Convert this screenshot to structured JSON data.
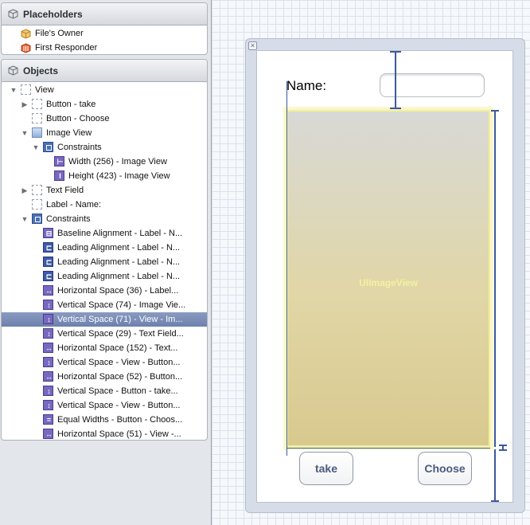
{
  "placeholders": {
    "header": "Placeholders",
    "items": [
      {
        "label": "File's Owner",
        "icon": "files-owner-icon"
      },
      {
        "label": "First Responder",
        "icon": "first-responder-icon"
      }
    ]
  },
  "objects": {
    "header": "Objects",
    "rows": [
      {
        "label": "View",
        "icon": "view-icon",
        "disclosure": "open"
      },
      {
        "label": "Button - take",
        "icon": "button-icon",
        "disclosure": "closed"
      },
      {
        "label": "Button - Choose",
        "icon": "button-icon",
        "disclosure": "none"
      },
      {
        "label": "Image View",
        "icon": "image-view-icon",
        "disclosure": "open"
      },
      {
        "label": "Constraints",
        "icon": "constraints-icon",
        "disclosure": "open"
      },
      {
        "label": "Width (256) - Image View",
        "icon": "width-constraint-icon",
        "disclosure": "none"
      },
      {
        "label": "Height (423) - Image View",
        "icon": "height-constraint-icon",
        "disclosure": "none"
      },
      {
        "label": "Text Field",
        "icon": "text-field-icon",
        "disclosure": "closed"
      },
      {
        "label": "Label - Name:",
        "icon": "label-icon",
        "disclosure": "none"
      },
      {
        "label": "Constraints",
        "icon": "constraints-icon",
        "disclosure": "open"
      },
      {
        "label": "Baseline Alignment - Label - N...",
        "icon": "baseline-constraint-icon",
        "disclosure": "none"
      },
      {
        "label": "Leading Alignment - Label - N...",
        "icon": "leading-constraint-icon",
        "disclosure": "none"
      },
      {
        "label": "Leading Alignment - Label - N...",
        "icon": "leading-constraint-icon",
        "disclosure": "none"
      },
      {
        "label": "Leading Alignment - Label - N...",
        "icon": "leading-constraint-icon",
        "disclosure": "none"
      },
      {
        "label": "Horizontal Space (36) - Label...",
        "icon": "horizontal-space-icon",
        "disclosure": "none"
      },
      {
        "label": "Vertical Space (74) - Image Vie...",
        "icon": "vertical-space-icon",
        "disclosure": "none"
      },
      {
        "label": "Vertical Space (71) - View - Im...",
        "icon": "vertical-space-icon",
        "disclosure": "none",
        "selected": true
      },
      {
        "label": "Vertical Space (29) - Text Field...",
        "icon": "vertical-space-icon",
        "disclosure": "none"
      },
      {
        "label": "Horizontal Space (152) - Text...",
        "icon": "horizontal-space-icon",
        "disclosure": "none"
      },
      {
        "label": "Vertical Space - View - Button...",
        "icon": "vertical-space-icon",
        "disclosure": "none"
      },
      {
        "label": "Horizontal Space (52) - Button...",
        "icon": "horizontal-space-icon",
        "disclosure": "none"
      },
      {
        "label": "Vertical Space - Button - take...",
        "icon": "vertical-space-icon",
        "disclosure": "none"
      },
      {
        "label": "Vertical Space - View - Button...",
        "icon": "vertical-space-icon",
        "disclosure": "none"
      },
      {
        "label": "Equal Widths - Button - Choos...",
        "icon": "equal-widths-icon",
        "disclosure": "none"
      },
      {
        "label": "Horizontal Space (51) - View -...",
        "icon": "horizontal-space-icon",
        "disclosure": "none"
      }
    ]
  },
  "canvas": {
    "name_label": "Name:",
    "image_view_caption": "UIImageView",
    "take_button": "take",
    "choose_button": "Choose",
    "close_glyph": "×"
  }
}
